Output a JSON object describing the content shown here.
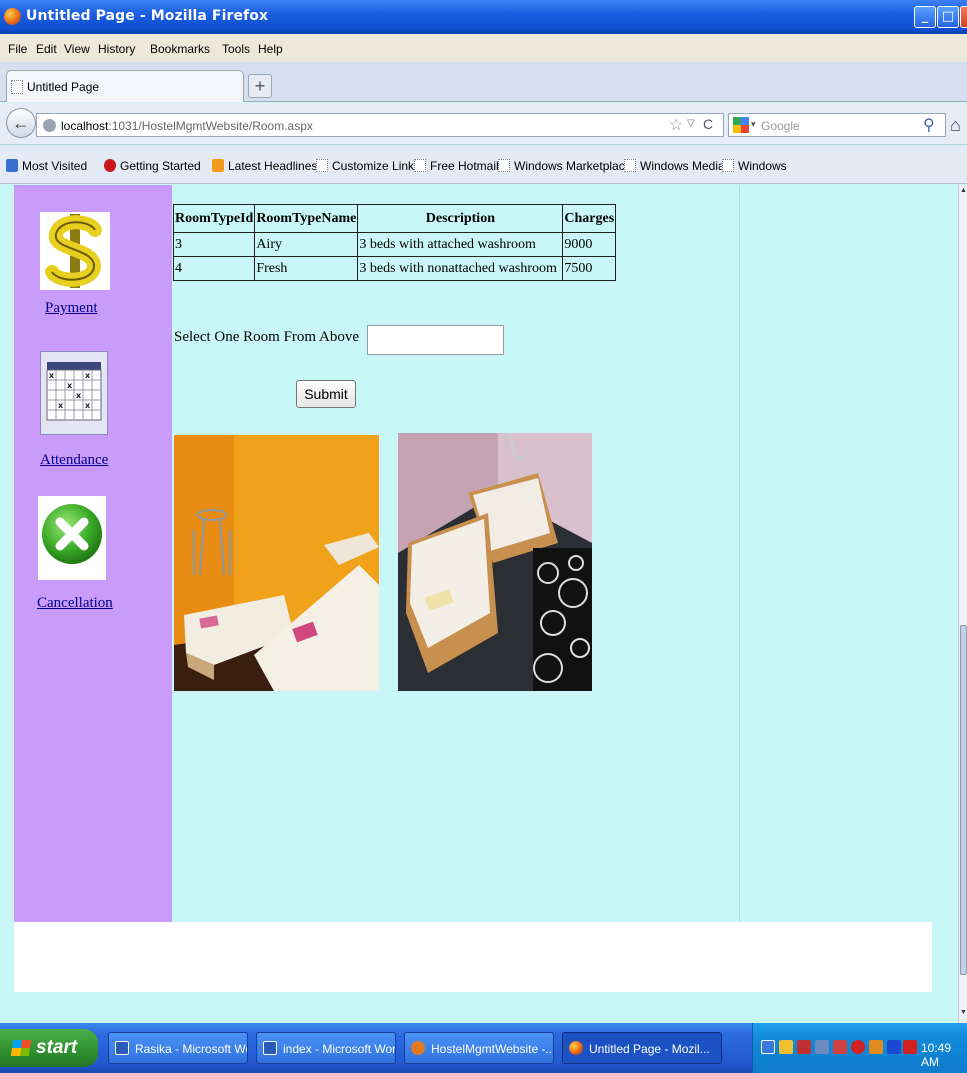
{
  "window": {
    "title": "Untitled Page - Mozilla Firefox"
  },
  "menu": [
    "File",
    "Edit",
    "View",
    "History",
    "Bookmarks",
    "Tools",
    "Help"
  ],
  "tabs": [
    {
      "label": "Untitled Page"
    }
  ],
  "address": {
    "host": "localhost",
    "path": ":1031/HostelMgmtWebsite/Room.aspx"
  },
  "search": {
    "placeholder": "Google"
  },
  "bookmarks": [
    "Most Visited",
    "Getting Started",
    "Latest Headlines",
    "Customize Links",
    "Free Hotmail",
    "Windows Marketplace",
    "Windows Media",
    "Windows"
  ],
  "sidebar": {
    "payment": "Payment",
    "attendance": "Attendance",
    "cancellation": "Cancellation"
  },
  "room_table": {
    "headers": [
      "RoomTypeId",
      "RoomTypeName",
      "Description",
      "Charges"
    ],
    "rows": [
      [
        "3",
        "Airy",
        "3 beds with attached washroom",
        "9000"
      ],
      [
        "4",
        "Fresh",
        "3 beds with nonattached washroom",
        "7500"
      ]
    ]
  },
  "form": {
    "select_label": "Select One Room From Above",
    "select_value": "",
    "submit_label": "Submit"
  },
  "taskbar": {
    "start": "start",
    "items": [
      "Rasika - Microsoft Word",
      "index - Microsoft Word",
      "HostelMgmtWebsite -...",
      "Untitled Page - Mozil..."
    ],
    "clock": "10:49 AM"
  },
  "colors": {
    "page_background": "#c9f7f7",
    "sidebar_background": "#c99bfa",
    "link": "#00008b"
  }
}
